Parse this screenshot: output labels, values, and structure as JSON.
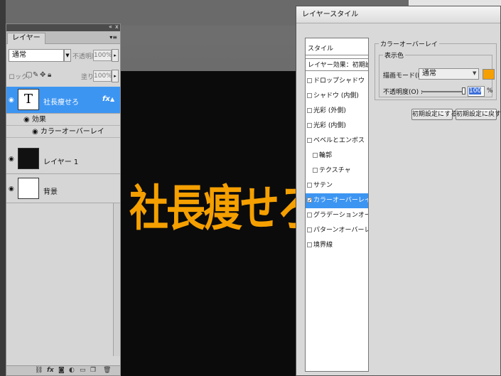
{
  "canvas": {
    "text": "社長痩せろ",
    "text_color": "#f5a000",
    "background": "#0b0b0b"
  },
  "layers_panel": {
    "collapse_icon": "«",
    "close_icon": "x",
    "tab_label": "レイヤー",
    "menu_icon": "▾≡",
    "blend_mode": "通常",
    "opacity_label": "不透明度:",
    "opacity_value": "100%",
    "lock_label": "ロック:",
    "fill_label": "塗り:",
    "fill_value": "100%",
    "layers": [
      {
        "name": "社長痩せろ",
        "type": "text",
        "thumb_glyph": "T",
        "fx": "fx",
        "selected": true
      },
      {
        "name": "レイヤー 1",
        "type": "pixel",
        "thumb_color": "#111111"
      },
      {
        "name": "背景",
        "type": "background",
        "thumb_color": "#ffffff"
      }
    ],
    "effects_label": "効果",
    "effect_item": "カラーオーバーレイ",
    "bottom_icons": [
      "link-icon",
      "fx-icon",
      "mask-icon",
      "adjustment-icon",
      "group-icon",
      "new-layer-icon",
      "trash-icon"
    ]
  },
  "layer_style": {
    "title": "レイヤースタイル",
    "style_header": "スタイル",
    "blending_header": "レイヤー効果：初期設定",
    "items": [
      {
        "label": "ドロップシャドウ",
        "checked": false,
        "indent": false
      },
      {
        "label": "シャドウ (内側)",
        "checked": false,
        "indent": false
      },
      {
        "label": "光彩 (外側)",
        "checked": false,
        "indent": false
      },
      {
        "label": "光彩 (内側)",
        "checked": false,
        "indent": false
      },
      {
        "label": "ベベルとエンボス",
        "checked": false,
        "indent": false
      },
      {
        "label": "輪郭",
        "checked": false,
        "indent": true
      },
      {
        "label": "テクスチャ",
        "checked": false,
        "indent": true
      },
      {
        "label": "サテン",
        "checked": false,
        "indent": false
      },
      {
        "label": "カラーオーバーレイ",
        "checked": true,
        "indent": false,
        "active": true
      },
      {
        "label": "グラデーションオーバーレイ",
        "checked": false,
        "indent": false
      },
      {
        "label": "パターンオーバーレイ",
        "checked": false,
        "indent": false
      },
      {
        "label": "境界線",
        "checked": false,
        "indent": false
      }
    ],
    "check_mark": "✓",
    "panel_title": "カラーオーバーレイ",
    "color_group_title": "表示色",
    "blend_mode_label": "描画モード(B) :",
    "blend_mode_value": "通常",
    "color_swatch": "#f5a000",
    "opacity_label": "不透明度(O) :",
    "opacity_value": "100",
    "opacity_unit": "%",
    "opacity_level": 1.0,
    "make_default_btn": "初期設定にする",
    "reset_default_btn": "初期設定に戻す"
  }
}
